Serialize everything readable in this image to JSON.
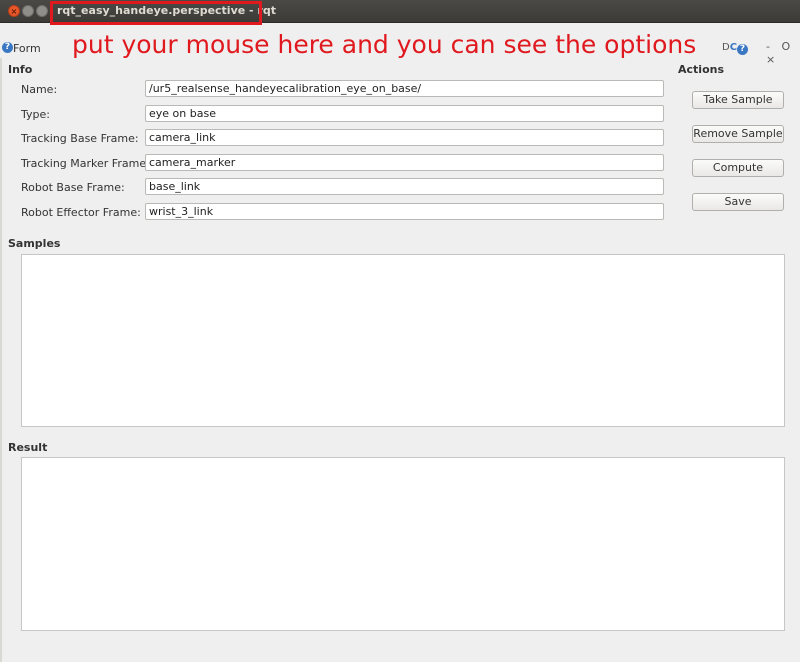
{
  "window": {
    "title": "rqt_easy_handeye.perspective - rqt"
  },
  "plugin": {
    "label": "Form",
    "annotation": "put your mouse here and you can see the options",
    "header_icons": "D",
    "header_right": "- O ×"
  },
  "info": {
    "title": "Info",
    "fields": [
      {
        "label": "Name:",
        "value": "/ur5_realsense_handeyecalibration_eye_on_base/"
      },
      {
        "label": "Type:",
        "value": "eye on base"
      },
      {
        "label": "Tracking Base Frame:",
        "value": "camera_link"
      },
      {
        "label": "Tracking Marker Frame:",
        "value": "camera_marker"
      },
      {
        "label": "Robot Base Frame:",
        "value": "base_link"
      },
      {
        "label": "Robot Effector Frame:",
        "value": "wrist_3_link"
      }
    ]
  },
  "actions": {
    "title": "Actions",
    "buttons": [
      "Take Sample",
      "Remove Sample",
      "Compute",
      "Save"
    ]
  },
  "samples": {
    "title": "Samples"
  },
  "result": {
    "title": "Result"
  },
  "colors": {
    "titlebar": "#3c3b37",
    "highlight": "#e0191f",
    "help_icon": "#3b78c3"
  }
}
